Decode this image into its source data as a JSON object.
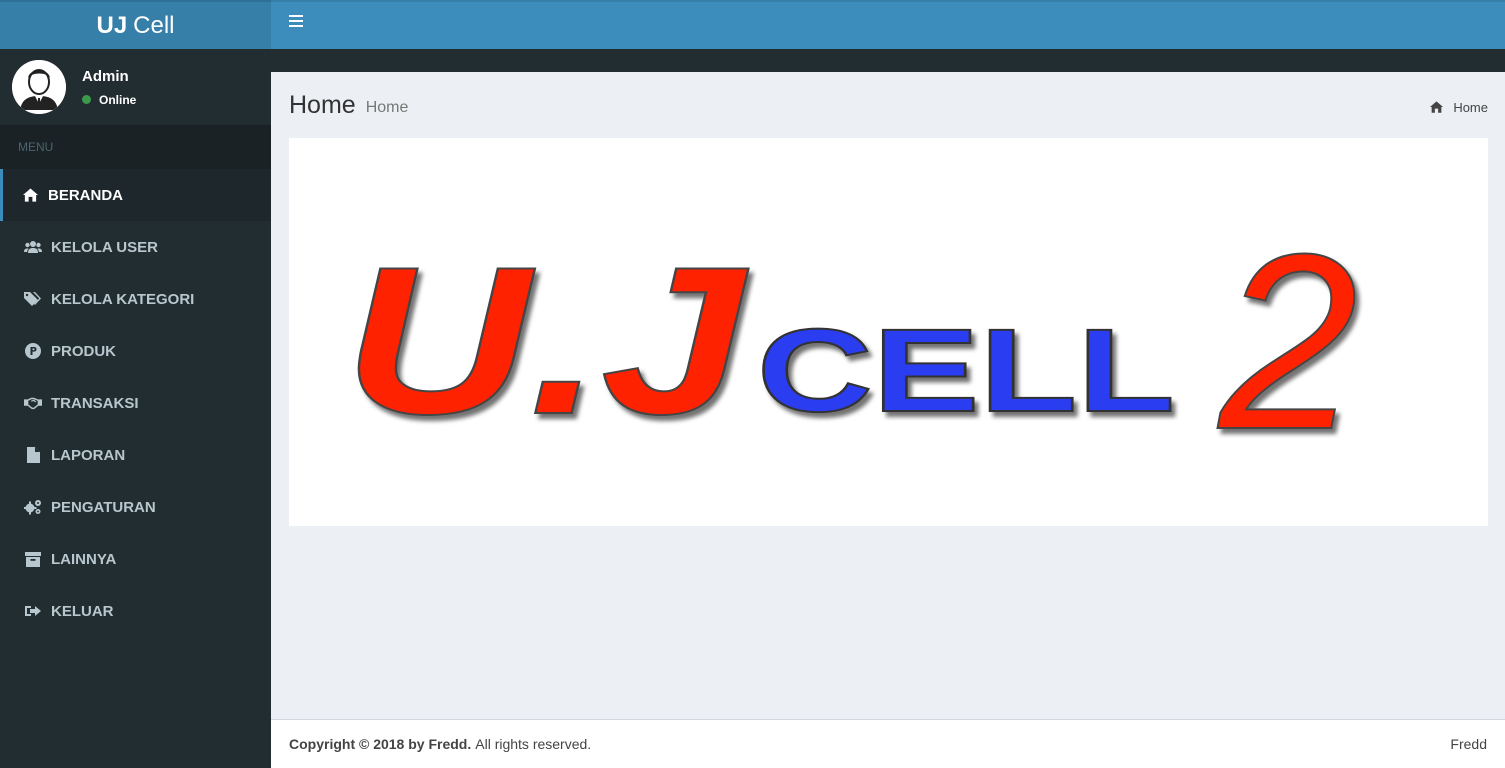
{
  "header": {
    "brand_bold": "UJ",
    "brand_light": "Cell",
    "toggle_icon": "bars-icon"
  },
  "user": {
    "name": "Admin",
    "status": "Online",
    "status_color": "#3c9b4a"
  },
  "sidebar": {
    "header": "MENU",
    "items": [
      {
        "label": "BERANDA",
        "icon": "home-icon",
        "active": true
      },
      {
        "label": "KELOLA USER",
        "icon": "users-icon",
        "active": false
      },
      {
        "label": "KELOLA KATEGORI",
        "icon": "tags-icon",
        "active": false
      },
      {
        "label": "PRODUK",
        "icon": "product-p-icon",
        "active": false
      },
      {
        "label": "TRANSAKSI",
        "icon": "handshake-icon",
        "active": false
      },
      {
        "label": "LAPORAN",
        "icon": "file-icon",
        "active": false
      },
      {
        "label": "PENGATURAN",
        "icon": "gears-icon",
        "active": false
      },
      {
        "label": "LAINNYA",
        "icon": "archive-icon",
        "active": false
      },
      {
        "label": "KELUAR",
        "icon": "sign-out-icon",
        "active": false
      }
    ]
  },
  "page": {
    "title": "Home",
    "subtitle": "Home",
    "breadcrumb": "Home"
  },
  "logo": {
    "part1": "U.J",
    "part2": "CELL",
    "part3": "2",
    "colors": {
      "red": "#ff2200",
      "blue": "#2a3cf0"
    }
  },
  "footer": {
    "copyright_bold": "Copyright © 2018 by Fredd.",
    "copyright_rest": "All rights reserved.",
    "right": "Fredd"
  },
  "colors": {
    "primary": "#3c8dbc",
    "primary_dark": "#367fa9",
    "sidebar_bg": "#222d32",
    "content_bg": "#ecf0f5"
  }
}
